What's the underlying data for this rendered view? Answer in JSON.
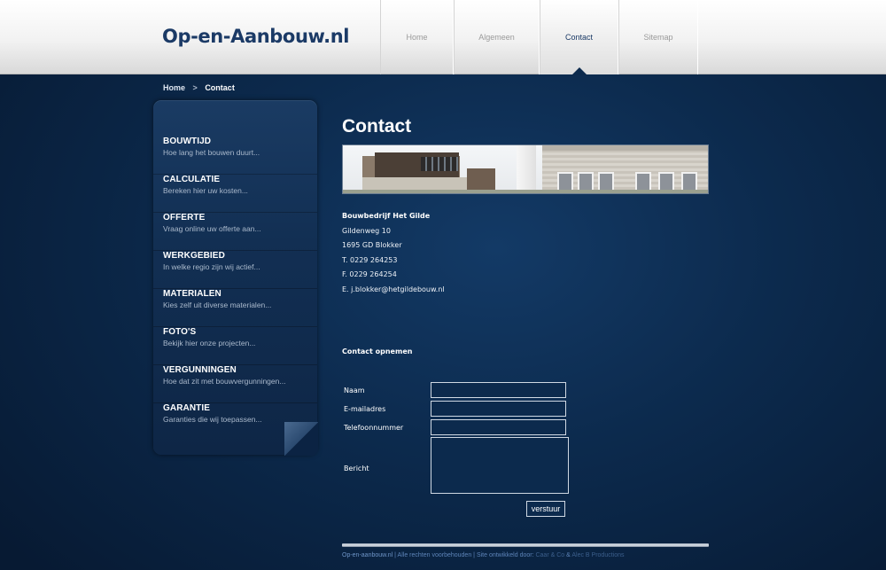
{
  "site": {
    "logo": "Op-en-Aanbouw.nl"
  },
  "nav": {
    "items": [
      {
        "label": "Home"
      },
      {
        "label": "Algemeen"
      },
      {
        "label": "Contact"
      },
      {
        "label": "Sitemap"
      }
    ],
    "active": "Contact"
  },
  "breadcrumb": {
    "home": "Home",
    "separator": ">",
    "current": "Contact"
  },
  "sidebar": {
    "items": [
      {
        "title": "BOUWTIJD",
        "subtitle": "Hoe lang het bouwen duurt..."
      },
      {
        "title": "CALCULATIE",
        "subtitle": "Bereken hier uw kosten..."
      },
      {
        "title": "OFFERTE",
        "subtitle": "Vraag online uw offerte aan..."
      },
      {
        "title": "WERKGEBIED",
        "subtitle": "In welke regio zijn wij actief..."
      },
      {
        "title": "MATERIALEN",
        "subtitle": "Kies zelf uit diverse materialen..."
      },
      {
        "title": "FOTO'S",
        "subtitle": "Bekijk hier onze projecten..."
      },
      {
        "title": "VERGUNNINGEN",
        "subtitle": "Hoe dat zit met bouwvergunningen..."
      },
      {
        "title": "GARANTIE",
        "subtitle": "Garanties die wij toepassen..."
      }
    ]
  },
  "main": {
    "title": "Contact",
    "company": {
      "name": "Bouwbedrijf Het Gilde",
      "street": "Gildenweg 10",
      "city": "1695 GD Blokker",
      "phone": "T. 0229 264253",
      "fax": "F. 0229 264254",
      "email": "E. j.blokker@hetgildebouw.nl"
    },
    "form": {
      "heading": "Contact opnemen",
      "name_label": "Naam",
      "email_label": "E-mailadres",
      "phone_label": "Telefoonnummer",
      "message_label": "Bericht",
      "name_value": "",
      "email_value": "",
      "phone_value": "",
      "message_value": "",
      "submit_label": "verstuur"
    }
  },
  "footer": {
    "site": "Op-en-aanbouw.nl",
    "sep1": " | ",
    "rights": "Alle rechten voorbehouden",
    "sep2": " | ",
    "developed": "Site ontwikkeld door: ",
    "dev1": "Caar & Co",
    "amp": " & ",
    "dev2": "Alec B Productions"
  },
  "colors": {
    "background": "#0c2a4d",
    "logo": "#1b3a66",
    "nav_active": "#1b3a66",
    "nav_inactive": "#9a9a9a",
    "footer_link": "#6f95c8"
  }
}
